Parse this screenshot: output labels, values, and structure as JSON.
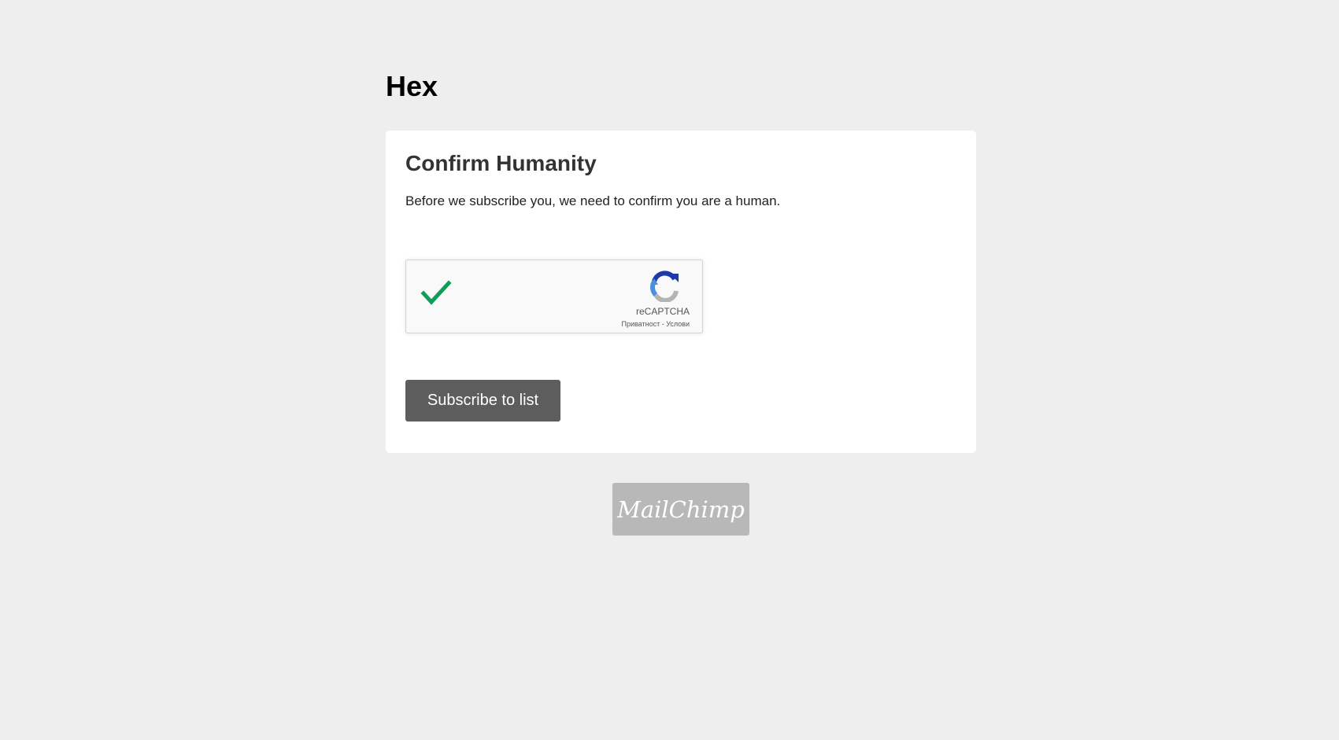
{
  "site": {
    "title": "Hex"
  },
  "card": {
    "heading": "Confirm Humanity",
    "text": "Before we subscribe you, we need to confirm you are a human."
  },
  "recaptcha": {
    "checked": true,
    "brand": "reCAPTCHA",
    "privacy_link": "Приватност",
    "separator": " - ",
    "terms_link": "Услови",
    "check_color": "#0f9d58",
    "logo_colors": [
      "#4a90e2",
      "#1c3aa9",
      "#b4b4b4"
    ],
    "logo_icon": "recaptcha-logo-icon"
  },
  "form": {
    "submit_label": "Subscribe to list",
    "button_color": "#5d5d5d"
  },
  "footer": {
    "badge_text": "MailChimp",
    "badge_color": "#b8b8b8"
  },
  "theme": {
    "background": "#eeeeee",
    "card_background": "#ffffff"
  }
}
